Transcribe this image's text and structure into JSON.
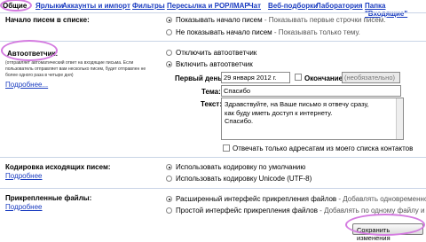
{
  "tabs": [
    "Общие",
    "Ярлыки",
    "Аккаунты и импорт",
    "Фильтры",
    "Пересылка и POP/IMAP",
    "Чат",
    "Веб-подборки",
    "Лаборатория",
    "Папка \"Входящие\""
  ],
  "snippets": {
    "label": "Начало писем в списке:",
    "option_show": "Показывать начало писем",
    "option_show_desc": " - Показывать первые строчки писем.",
    "option_hide": "Не показывать начало писем",
    "option_hide_desc": " - Показывать только тему."
  },
  "autoreply": {
    "label": "Автоответчик:",
    "description": "(отправляет автоматический ответ на входящие письма. Если пользователь отправляет вам несколько писем, будет отправлен не более одного раза в четыре дня)",
    "more_link": "Подробнее...",
    "option_off": "Отключить автоответчик",
    "option_on": "Включить автоответчик",
    "first_day_label": "Первый день:",
    "first_day_value": "29 января 2012 г.",
    "end_label": "Окончание:",
    "end_placeholder": "(необязательно)",
    "subject_label": "Тема:",
    "subject_value": "Спасибо",
    "message_label": "Текст:",
    "message_lines": [
      "Здравствуйте, на Ваше письмо я отвечу сразу,",
      "как буду иметь доступ к интернету.",
      "Спасибо."
    ],
    "contacts_only": "Отвечать только адресатам из моего списка контактов"
  },
  "encoding": {
    "label": "Кодировка исходящих писем:",
    "more_link": "Подробнее",
    "option_default": "Использовать кодировку по умолчанию",
    "option_unicode": "Использовать кодировку Unicode (UTF-8)"
  },
  "attachments": {
    "label": "Прикрепленные файлы:",
    "more_link": "Подробнее",
    "option_advanced": "Расширенный интерфейс прикрепления файлов",
    "option_advanced_desc": " - Добавлять одновременно нес",
    "option_simple": "Простой интерфейс прикрепления файлов",
    "option_simple_desc": " - Добавлять по одному файлу и не"
  },
  "save_button": "Сохранить изменения",
  "colors": {
    "link": "#1a3cc0",
    "highlight": "#d47be0",
    "divider": "#c9d4e6"
  }
}
